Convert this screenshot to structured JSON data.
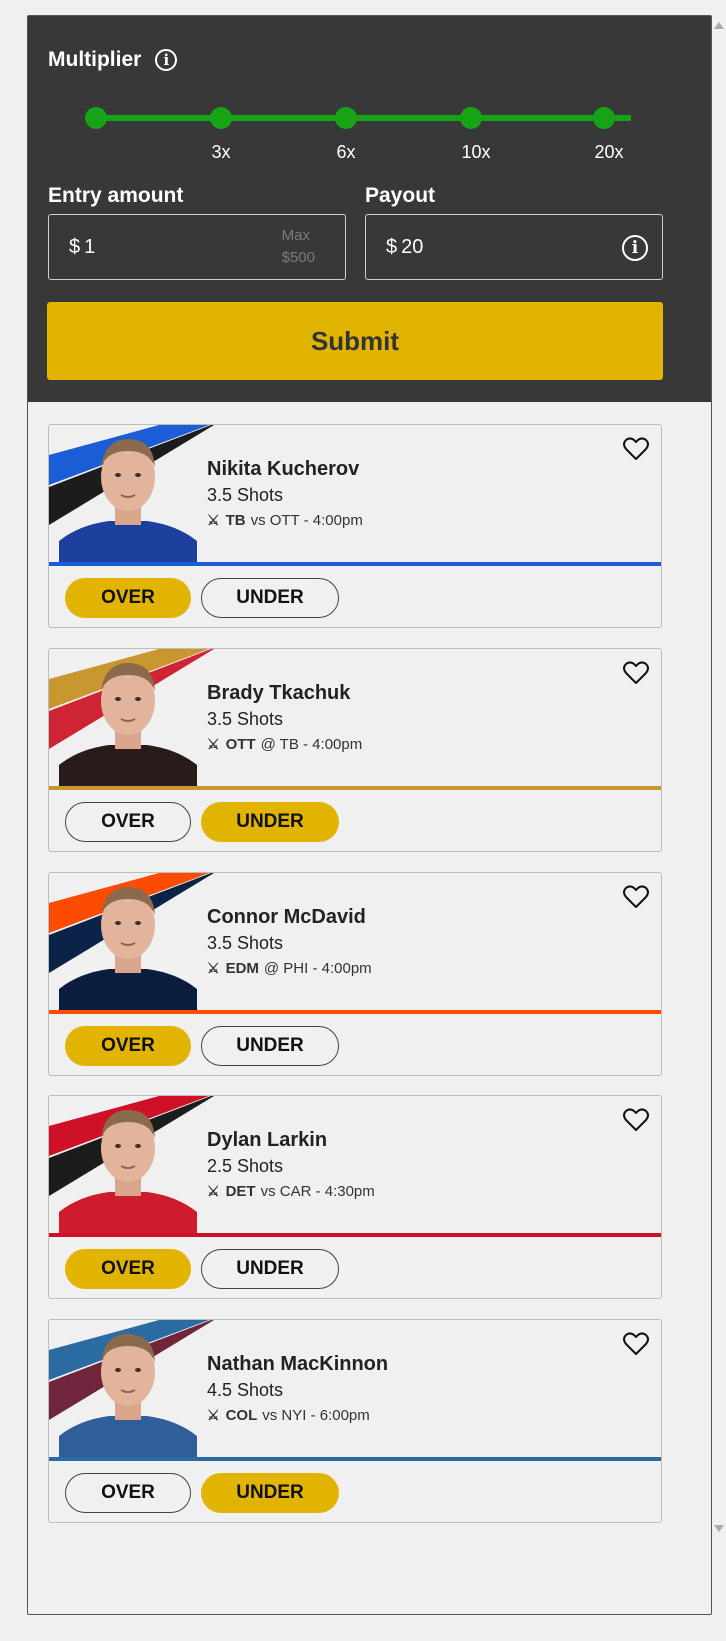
{
  "multiplier": {
    "title": "Multiplier",
    "steps": [
      "",
      "3x",
      "6x",
      "10x",
      "20x"
    ],
    "color": "#16a316"
  },
  "entry": {
    "label": "Entry amount",
    "currency": "$",
    "value": "1",
    "max_label": "Max",
    "max_value": "$500"
  },
  "payout": {
    "label": "Payout",
    "currency": "$",
    "value": "20"
  },
  "submit_label": "Submit",
  "accent": "#e0b400",
  "players": [
    {
      "name": "Nikita Kucherov",
      "stat": "3.5 Shots",
      "team": "TB",
      "matchup": "vs OTT - 4:00pm",
      "selection": "OVER",
      "colors": [
        "#1a5dd6",
        "#1c1c1c"
      ],
      "line": "#1a5dd6",
      "jersey": "#1d3f9e"
    },
    {
      "name": "Brady Tkachuk",
      "stat": "3.5 Shots",
      "team": "OTT",
      "matchup": "@ TB - 4:00pm",
      "selection": "UNDER",
      "colors": [
        "#c9972f",
        "#cf2434"
      ],
      "line": "#c9972f",
      "jersey": "#2a1a1a"
    },
    {
      "name": "Connor McDavid",
      "stat": "3.5 Shots",
      "team": "EDM",
      "matchup": "@ PHI - 4:00pm",
      "selection": "OVER",
      "colors": [
        "#fc4c02",
        "#0a2346"
      ],
      "line": "#fc4c02",
      "jersey": "#0b1e3f"
    },
    {
      "name": "Dylan Larkin",
      "stat": "2.5 Shots",
      "team": "DET",
      "matchup": "vs CAR - 4:30pm",
      "selection": "OVER",
      "colors": [
        "#ce1126",
        "#1c1c1c"
      ],
      "line": "#ce1126",
      "jersey": "#cf1c2c"
    },
    {
      "name": "Nathan MacKinnon",
      "stat": "4.5 Shots",
      "team": "COL",
      "matchup": "vs NYI - 6:00pm",
      "selection": "UNDER",
      "colors": [
        "#2a6ba1",
        "#6f263d"
      ],
      "line": "#2a6ba1",
      "jersey": "#2f5f9a"
    }
  ],
  "over_label": "OVER",
  "under_label": "UNDER"
}
